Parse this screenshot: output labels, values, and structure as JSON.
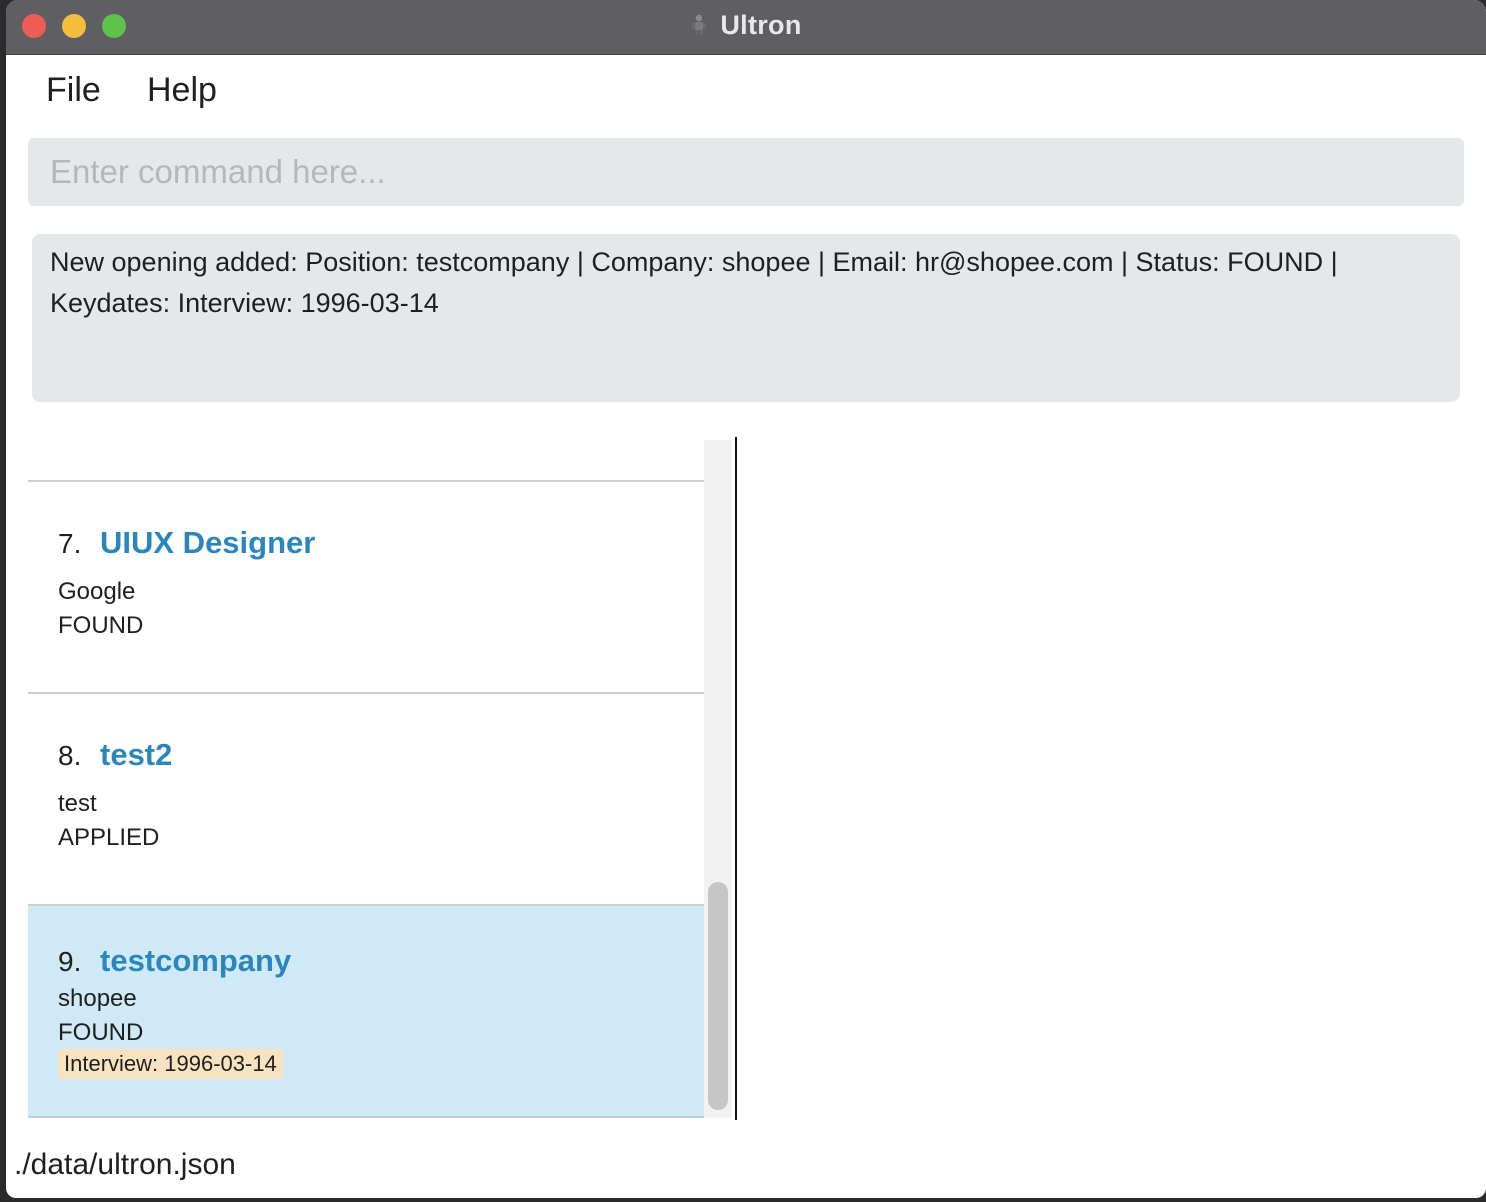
{
  "window": {
    "title": "Ultron"
  },
  "menu": {
    "file_label": "File",
    "help_label": "Help"
  },
  "command": {
    "placeholder": "Enter command here...",
    "value": ""
  },
  "result": {
    "line1": "New opening added: Position: testcompany | Company: shopee | Email: hr@shopee.com | Status: FOUND |",
    "line2": "Keydates: Interview: 1996-03-14"
  },
  "openings": [
    {
      "index": "7.",
      "position": "UIUX Designer",
      "company": "Google",
      "status": "FOUND",
      "keydate": ""
    },
    {
      "index": "8.",
      "position": "test2",
      "company": "test",
      "status": "APPLIED",
      "keydate": ""
    },
    {
      "index": "9.",
      "position": "testcompany",
      "company": "shopee",
      "status": "FOUND",
      "keydate": "Interview: 1996-03-14"
    }
  ],
  "status_bar": {
    "path": "./data/ultron.json"
  },
  "colors": {
    "accent": "#2a86bd",
    "selected_row": "#cfe9f7",
    "keydate_badge": "#f8e3c0",
    "input_background": "#e5e8eb"
  }
}
